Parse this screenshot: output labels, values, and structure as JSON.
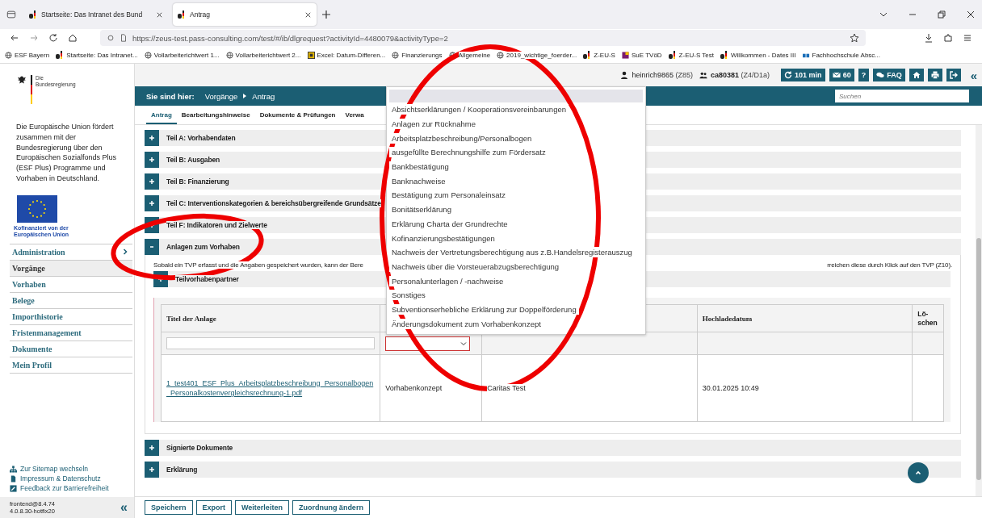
{
  "browser": {
    "tabs": [
      {
        "title": "Startseite: Das Intranet des Bund",
        "selected": false
      },
      {
        "title": "Antrag",
        "selected": true
      }
    ],
    "url": "https://zeus-test.pass-consulting.com/test/#/ib/dlgrequest?activityId=4480079&activityType=2",
    "bookmarks": [
      {
        "label": "ESF Bayern",
        "kind": "globe"
      },
      {
        "label": "Startseite: Das Intranet...",
        "kind": "logo"
      },
      {
        "label": "Vollarbeiterichtwert 1...",
        "kind": "globe"
      },
      {
        "label": "Vollarbeiterichtwert 2...",
        "kind": "globe"
      },
      {
        "label": "Excel: Datum-Differen...",
        "kind": "sheet"
      },
      {
        "label": "Finanzierungs",
        "kind": "globe"
      },
      {
        "label": "Allgemeine",
        "kind": "globe"
      },
      {
        "label": "2019_wichtige_foerder...",
        "kind": "globe"
      },
      {
        "label": "Z-EU-S",
        "kind": "logo"
      },
      {
        "label": "SuE TVöD",
        "kind": "square"
      },
      {
        "label": "Z-EU-S Test",
        "kind": "logo"
      },
      {
        "label": "Willkommen - Dates III",
        "kind": "logo"
      },
      {
        "label": "Fachhochschule Absc...",
        "kind": "books"
      }
    ]
  },
  "header": {
    "user": "heinrich9865",
    "user_org": "(Z85)",
    "account": "ca80381",
    "account_org": "(Z4/D1a)",
    "buttons": [
      {
        "kind": "refresh",
        "label": "101 min"
      },
      {
        "kind": "mail",
        "label": "60"
      },
      {
        "kind": "help",
        "label": "?"
      },
      {
        "kind": "faq",
        "label": "FAQ"
      },
      {
        "kind": "home"
      },
      {
        "kind": "print"
      },
      {
        "kind": "logout"
      }
    ],
    "collapse": "«"
  },
  "breadcrumb": {
    "label": "Sie sind hier:",
    "items": [
      "Vorgänge",
      "Antrag"
    ]
  },
  "search": {
    "placeholder": "Suchen"
  },
  "tabs": [
    {
      "label": "Antrag",
      "selected": true
    },
    {
      "label": "Bearbeitungshinweise",
      "selected": false
    },
    {
      "label": "Dokumente & Prüfungen",
      "selected": false
    },
    {
      "label": "Verwa",
      "selected": false
    }
  ],
  "sidebar": {
    "logo_lines": [
      "Die",
      "Bundesregierung"
    ],
    "eu_text": "Die Europäische Union fördert zusammen mit der Bundesregierung über den Europäischen Sozialfonds Plus (ESF Plus) Programme und Vorhaben in Deutschland.",
    "eu_caption": "Kofinanziert von der Europäischen Union",
    "items": [
      {
        "label": "Administration",
        "selected": false,
        "submenu": true
      },
      {
        "label": "Vorgänge",
        "selected": true,
        "submenu": false
      },
      {
        "label": "Vorhaben",
        "selected": false,
        "submenu": false
      },
      {
        "label": "Belege",
        "selected": false,
        "submenu": false
      },
      {
        "label": "Importhistorie",
        "selected": false,
        "submenu": false
      },
      {
        "label": "Fristenmanagement",
        "selected": false,
        "submenu": false
      },
      {
        "label": "Dokumente",
        "selected": false,
        "submenu": false
      },
      {
        "label": "Mein Profil",
        "selected": false,
        "submenu": false
      }
    ],
    "footer_links": [
      {
        "kind": "sitemap",
        "label": "Zur Sitemap wechseln"
      },
      {
        "kind": "document",
        "label": "Impressum & Datenschutz"
      },
      {
        "kind": "edit",
        "label": "Feedback zur Barrierefreiheit"
      }
    ],
    "version": [
      "frontend@8.4.74",
      "4.0.8.30-hotfix20"
    ],
    "collapse": "«"
  },
  "sections": [
    {
      "title": "Teil A: Vorhabendaten",
      "expanded": false
    },
    {
      "title": "Teil B: Ausgaben",
      "expanded": false
    },
    {
      "title": "Teil B: Finanzierung",
      "expanded": false
    },
    {
      "title": "Teil C: Interventionskategorien & bereichsübergreifende Grundsätze",
      "expanded": false
    },
    {
      "title": "Teil F: Indikatoren und Zielwerte",
      "expanded": false
    },
    {
      "title": "Anlagen zum Vorhaben",
      "expanded": true
    }
  ],
  "attachments": {
    "intro_start": "Sobald ein TVP erfasst und die Angaben gespeichert wurden, kann der Bere",
    "intro_end": "rreichen diese durch Klick auf den TVP (Z10).",
    "subsection": {
      "title": "Teilvorhabenpartner",
      "expanded": false
    },
    "table": {
      "column_1": "Titel der Anlage",
      "column_4": "Hochladedatum",
      "column_5": "Lö-schen",
      "rows": [
        {
          "file": "1_test401_ESF_Plus_Arbeitsplatzbeschreibung_Personalbogen_Personalkostenvergleichsrechnung-1.pdf",
          "column_2": "Vorhabenkonzept",
          "column_3": "Caritas Test",
          "date": "30.01.2025 10:49"
        }
      ]
    }
  },
  "later_sections": [
    {
      "title": "Signierte Dokumente",
      "expanded": false
    },
    {
      "title": "Erklärung",
      "expanded": false
    }
  ],
  "dropdown": {
    "options": [
      "Absichtserklärungen / Kooperationsvereinbarungen",
      "Anlagen zur Rücknahme",
      "Arbeitsplatzbeschreibung/Personalbogen",
      "ausgefüllte Berechnungshilfe zum Fördersatz",
      "Bankbestätigung",
      "Banknachweise",
      "Bestätigung zum Personaleinsatz",
      "Bonitätserklärung",
      "Erklärung Charta der Grundrechte",
      "Kofinanzierungsbestätigungen",
      "Nachweis der Vertretungsberechtigung aus z.B.Handelsregisterauszug",
      "Nachweis über die Vorsteuerabzugsberechtigung",
      "Personalunterlagen / -nachweise",
      "Sonstiges",
      "Subventionserhebliche Erklärung zur Doppelförderung",
      "Änderungsdokument zum Vorhabenkonzept"
    ]
  },
  "actions": [
    "Speichern",
    "Export",
    "Weiterleiten",
    "Zuordnung ändern"
  ]
}
